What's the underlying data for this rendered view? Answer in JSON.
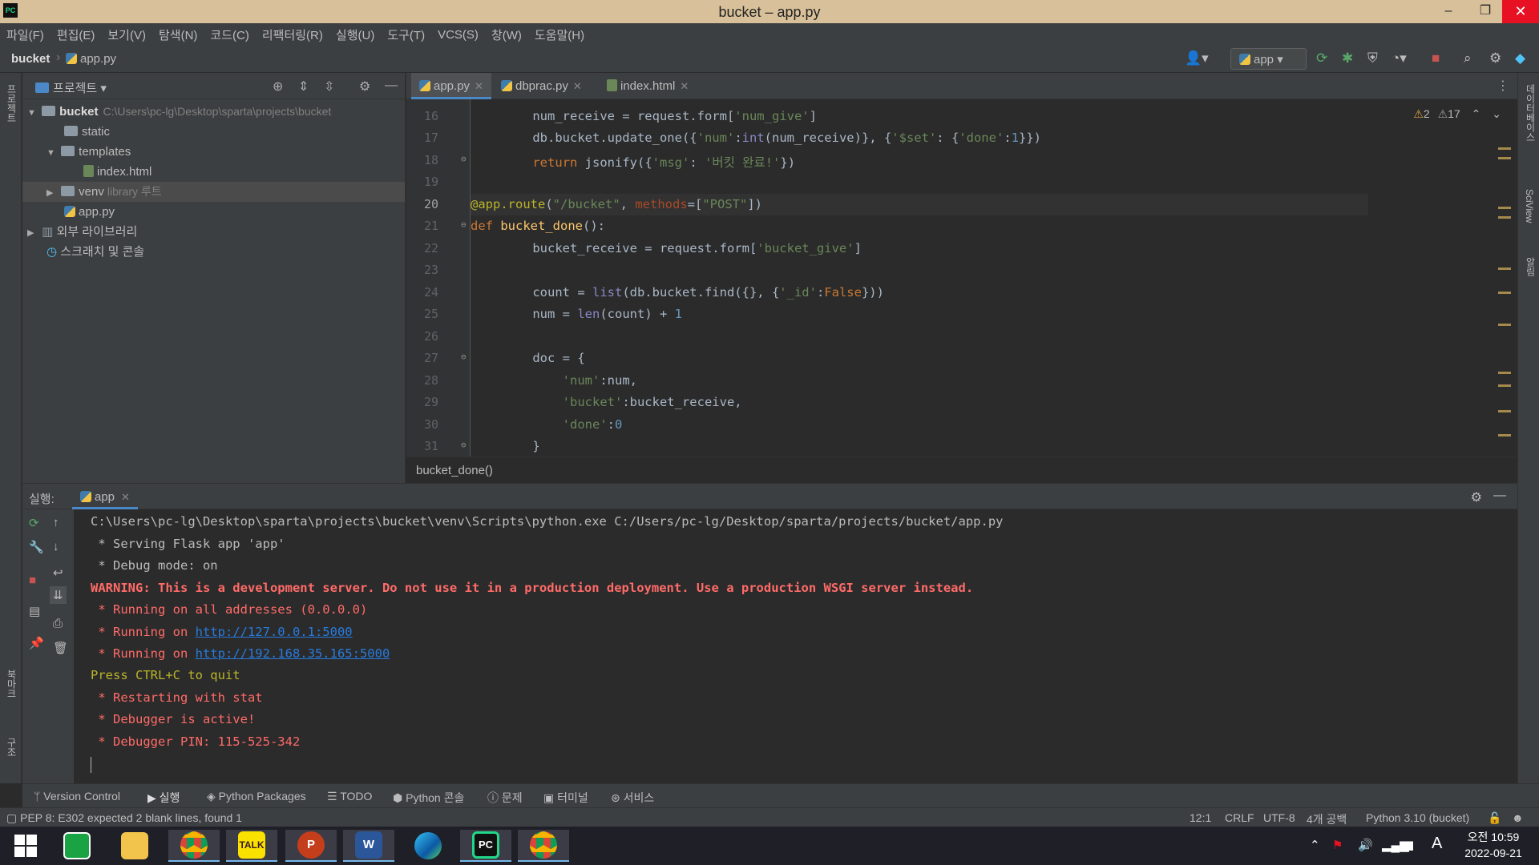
{
  "window": {
    "title": "bucket – app.py",
    "logo": "PC",
    "minimize_icon": "–",
    "restore_icon": "❐",
    "close_icon": "✕"
  },
  "menu": [
    "파일(F)",
    "편집(E)",
    "보기(V)",
    "탐색(N)",
    "코드(C)",
    "리팩터링(R)",
    "실행(U)",
    "도구(T)",
    "VCS(S)",
    "창(W)",
    "도움말(H)"
  ],
  "nav": {
    "project": "bucket",
    "file": "app.py",
    "run_config": "app"
  },
  "left_strip": {
    "project_label": "프로젝트",
    "bookmarks_label": "북마크",
    "structure_label": "구조"
  },
  "right_strip": {
    "database_label": "데이터베이스",
    "sciview_label": "SciView",
    "notifications_label": "알림"
  },
  "project_panel": {
    "title": "프로젝트",
    "tree": [
      {
        "label": "bucket",
        "path": "C:\\Users\\pc-lg\\Desktop\\sparta\\projects\\bucket"
      },
      {
        "label": "static"
      },
      {
        "label": "templates"
      },
      {
        "label": "index.html"
      },
      {
        "label": "venv",
        "muted": "library 루트"
      },
      {
        "label": "app.py"
      },
      {
        "label": "외부 라이브러리"
      },
      {
        "label": "스크래치 및 콘솔"
      }
    ]
  },
  "tabs": [
    {
      "label": "app.py",
      "active": true
    },
    {
      "label": "dbprac.py",
      "active": false
    },
    {
      "label": "index.html",
      "active": false
    }
  ],
  "editor": {
    "warnings": "2",
    "weak_warnings": "17",
    "current_line": 20,
    "line_numbers": [
      16,
      17,
      18,
      19,
      20,
      21,
      22,
      23,
      24,
      25,
      26,
      27,
      28,
      29,
      30,
      31
    ],
    "function_breadcrumb": "bucket_done()"
  },
  "run": {
    "label": "실행:",
    "tab": "app",
    "console": [
      {
        "text": "C:\\Users\\pc-lg\\Desktop\\sparta\\projects\\bucket\\venv\\Scripts\\python.exe C:/Users/pc-lg/Desktop/sparta/projects/bucket/app.py",
        "style": "white"
      },
      {
        "text": " * Serving Flask app 'app'",
        "style": "white"
      },
      {
        "text": " * Debug mode: on",
        "style": "white"
      },
      {
        "text": "WARNING: This is a development server. Do not use it in a production deployment. Use a production WSGI server instead.",
        "style": "redb"
      },
      {
        "text": " * Running on all addresses (0.0.0.0)",
        "style": "red"
      },
      {
        "text": " * Running on ",
        "style": "red",
        "link": "http://127.0.0.1:5000"
      },
      {
        "text": " * Running on ",
        "style": "red",
        "link": "http://192.168.35.165:5000"
      },
      {
        "text": "Press CTRL+C to quit",
        "style": "yellow"
      },
      {
        "text": " * Restarting with stat",
        "style": "red"
      },
      {
        "text": " * Debugger is active!",
        "style": "red"
      },
      {
        "text": " * Debugger PIN: 115-525-342",
        "style": "red"
      }
    ]
  },
  "bottom_tools": [
    "Version Control",
    "실행",
    "Python Packages",
    "TODO",
    "Python 콘솔",
    "문제",
    "터미널",
    "서비스"
  ],
  "status": {
    "message": "PEP 8: E302 expected 2 blank lines, found 1",
    "position": "12:1",
    "line_ending": "CRLF",
    "encoding": "UTF-8",
    "indent": "4개 공백",
    "interpreter": "Python 3.10 (bucket)"
  },
  "taskbar": {
    "time": "오전 10:59",
    "date": "2022-09-21",
    "ime": "A",
    "kakao_label": "TALK",
    "powerpoint_label": "P",
    "word_label": "W",
    "pycharm_label": "PC"
  }
}
